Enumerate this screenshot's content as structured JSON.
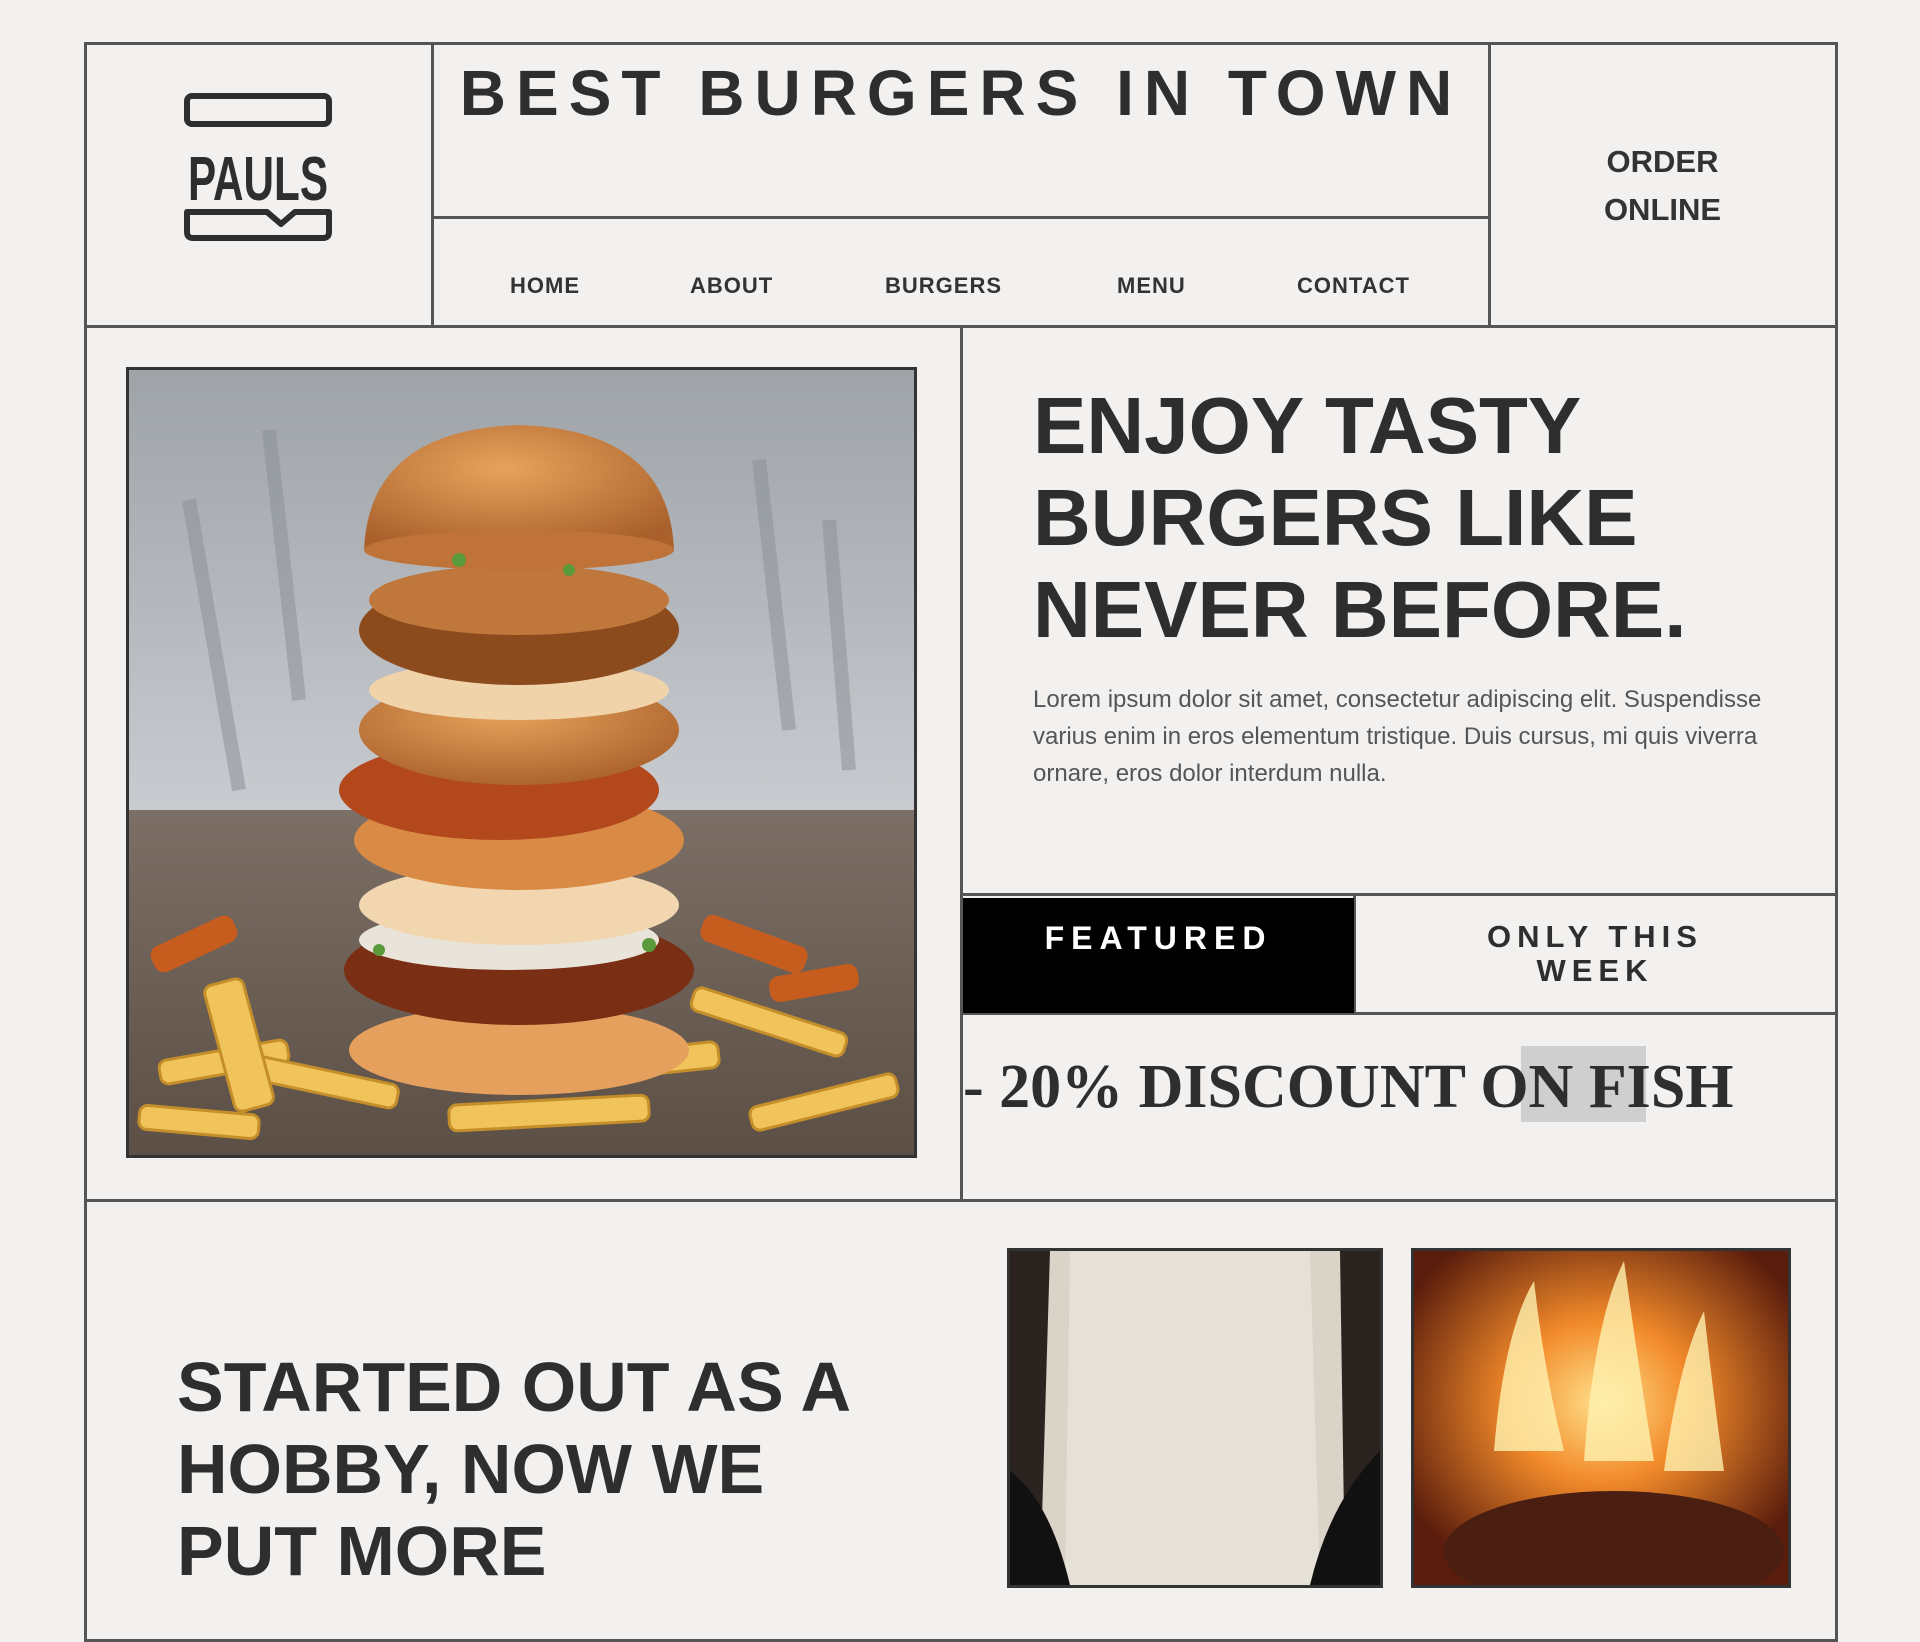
{
  "brand": {
    "logo_text": "PAULS"
  },
  "header": {
    "title": "BEST BURGERS IN TOWN",
    "order_line1": "ORDER",
    "order_line2": "ONLINE"
  },
  "nav": {
    "items": [
      {
        "label": "HOME"
      },
      {
        "label": "ABOUT"
      },
      {
        "label": "BURGERS"
      },
      {
        "label": "MENU"
      },
      {
        "label": "CONTACT"
      }
    ]
  },
  "hero": {
    "image_alt": "stacked-burger-photo",
    "headline": "ENJOY TASTY BURGERS LIKE NEVER BEFORE.",
    "body": "Lorem ipsum dolor sit amet, consectetur adipiscing elit. Suspendisse varius enim in eros elementum tristique. Duis cursus, mi quis viverra ornare, eros dolor interdum nulla."
  },
  "promo": {
    "featured_label": "FEATURED",
    "only_line1": "ONLY THIS",
    "only_line2": "WEEK",
    "discount": "- 20% DISCOUNT ON FISH"
  },
  "story": {
    "headline": "STARTED OUT AS A HOBBY, NOW WE PUT MORE"
  },
  "colors": {
    "background": "#f3f1ef",
    "ink": "#2e2e2e",
    "featured_bg": "#000000",
    "highlight": "#cfcfcf"
  }
}
